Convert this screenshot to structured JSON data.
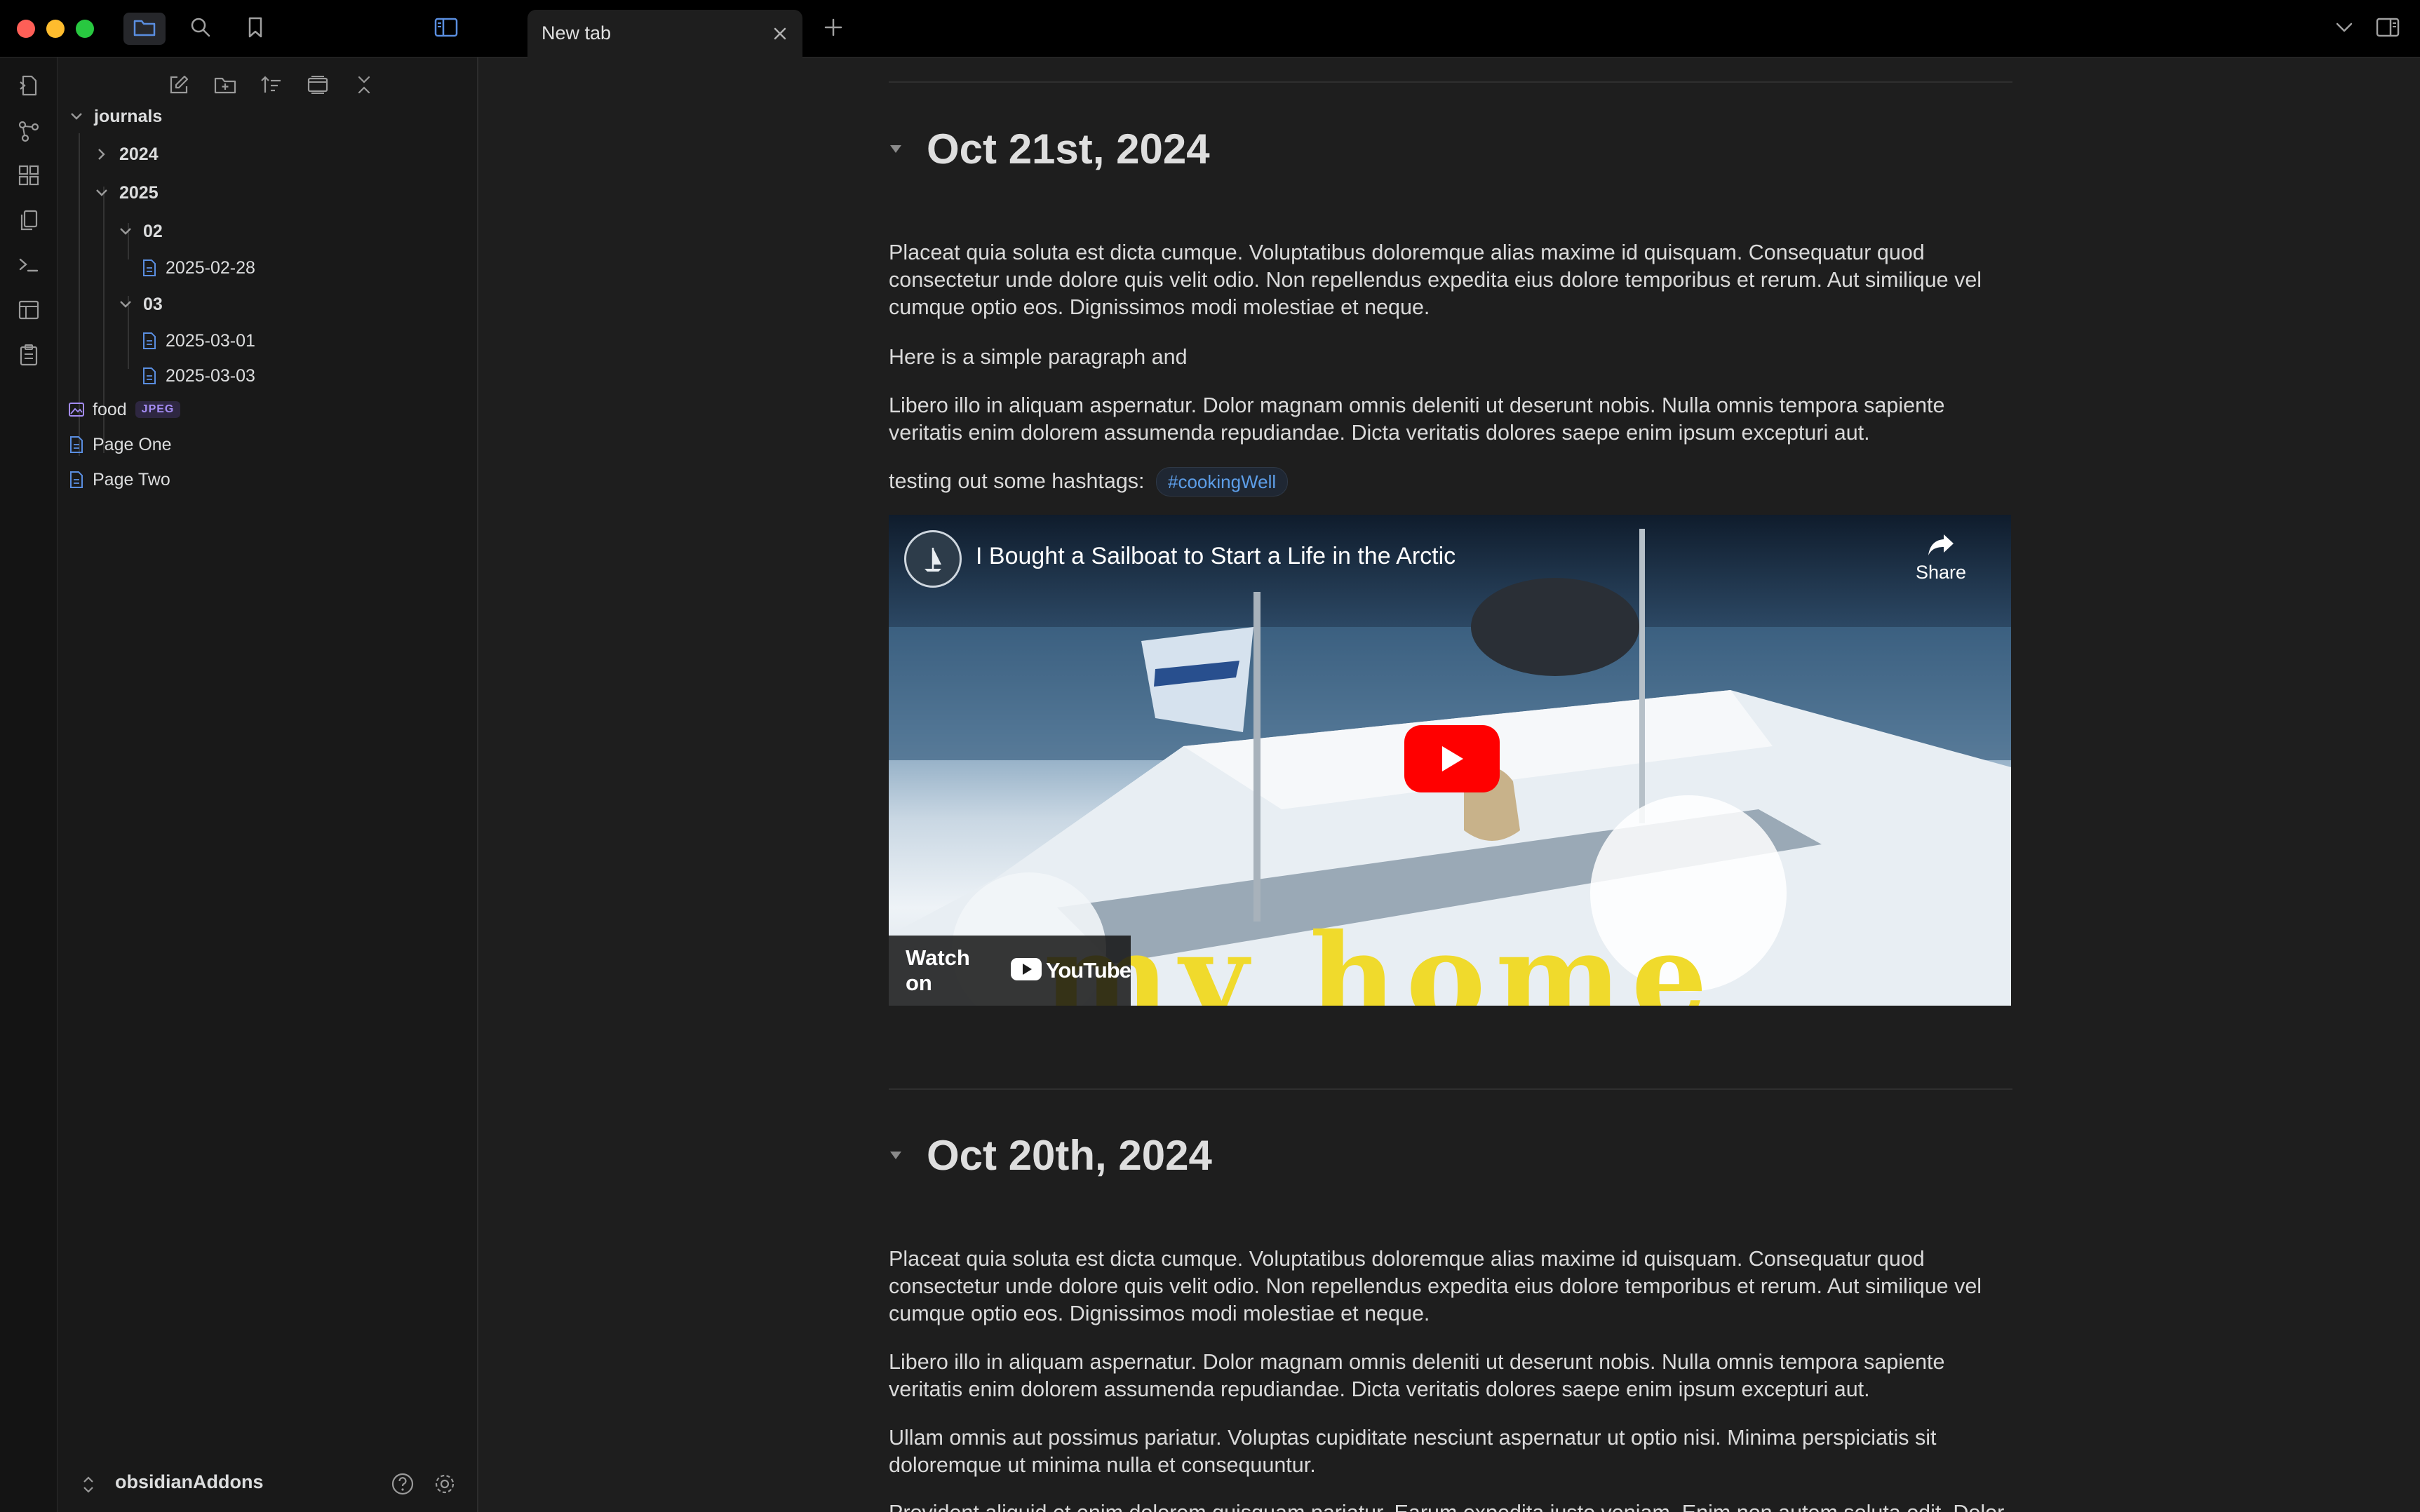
{
  "tab": {
    "title": "New tab"
  },
  "sidebar": {
    "tree": [
      {
        "label": "journals"
      },
      {
        "label": "2024"
      },
      {
        "label": "2025"
      },
      {
        "label": "02"
      },
      {
        "label": "2025-02-28"
      },
      {
        "label": "03"
      },
      {
        "label": "2025-03-01"
      },
      {
        "label": "2025-03-03"
      },
      {
        "label": "food",
        "badge": "JPEG"
      },
      {
        "label": "Page One"
      },
      {
        "label": "Page Two"
      }
    ],
    "vault_name": "obsidianAddons"
  },
  "entries": [
    {
      "date": "Oct 21st, 2024",
      "p1": "Placeat quia soluta est dicta cumque. Voluptatibus doloremque alias maxime id quisquam. Consequatur quod consectetur unde dolore quis velit odio. Non repellendus expedita eius dolore temporibus et rerum. Aut similique vel cumque optio eos. Dignissimos modi molestiae et neque.",
      "p2": "Here is a simple paragraph and",
      "p3": "Libero illo in aliquam aspernatur. Dolor magnam omnis deleniti ut deserunt nobis. Nulla omnis tempora sapiente veritatis enim dolorem assumenda repudiandae. Dicta veritatis dolores saepe enim ipsum excepturi aut.",
      "p4": "testing out some hashtags:",
      "tag": "#cookingWell",
      "video": {
        "title": "I Bought a Sailboat to Start a Life in the Arctic",
        "share": "Share",
        "watch_on": "Watch on",
        "youtube": "YouTube",
        "overlay_text": "my home"
      }
    },
    {
      "date": "Oct 20th, 2024",
      "p1": "Placeat quia soluta est dicta cumque. Voluptatibus doloremque alias maxime id quisquam. Consequatur quod consectetur unde dolore quis velit odio. Non repellendus expedita eius dolore temporibus et rerum. Aut similique vel cumque optio eos. Dignissimos modi molestiae et neque.",
      "p2": "Libero illo in aliquam aspernatur. Dolor magnam omnis deleniti ut deserunt nobis. Nulla omnis tempora sapiente veritatis enim dolorem assumenda repudiandae. Dicta veritatis dolores saepe enim ipsum excepturi aut.",
      "p3": "Ullam omnis aut possimus pariatur. Voluptas cupiditate nesciunt aspernatur ut optio nisi. Minima perspiciatis sit doloremque ut minima nulla et consequuntur.",
      "p4": "Provident aliquid et enim dolorem quisquam pariatur. Earum expedita iusto veniam. Enim non autem soluta odit. Dolor"
    }
  ],
  "colors": {
    "background": "#1e1e1e",
    "sidebar": "#191919",
    "accent": "#5d9ee8",
    "badge": "#a48cf4",
    "youtube_red": "#ff0000",
    "overlay_yellow": "#f0da2c"
  },
  "icons": {
    "titlebar": [
      "folder-icon",
      "search-icon",
      "bookmark-icon",
      "sidebar-toggle-icon",
      "plus-icon",
      "chevron-down-icon",
      "right-sidebar-icon"
    ],
    "ribbon": [
      "open-quick-switcher-icon",
      "graph-icon",
      "canvas-icon",
      "copy-icon",
      "terminal-icon",
      "template-icon",
      "daily-note-icon"
    ],
    "nav": [
      "new-note-icon",
      "new-folder-icon",
      "sort-icon",
      "auto-reveal-icon",
      "collapse-all-icon"
    ]
  }
}
